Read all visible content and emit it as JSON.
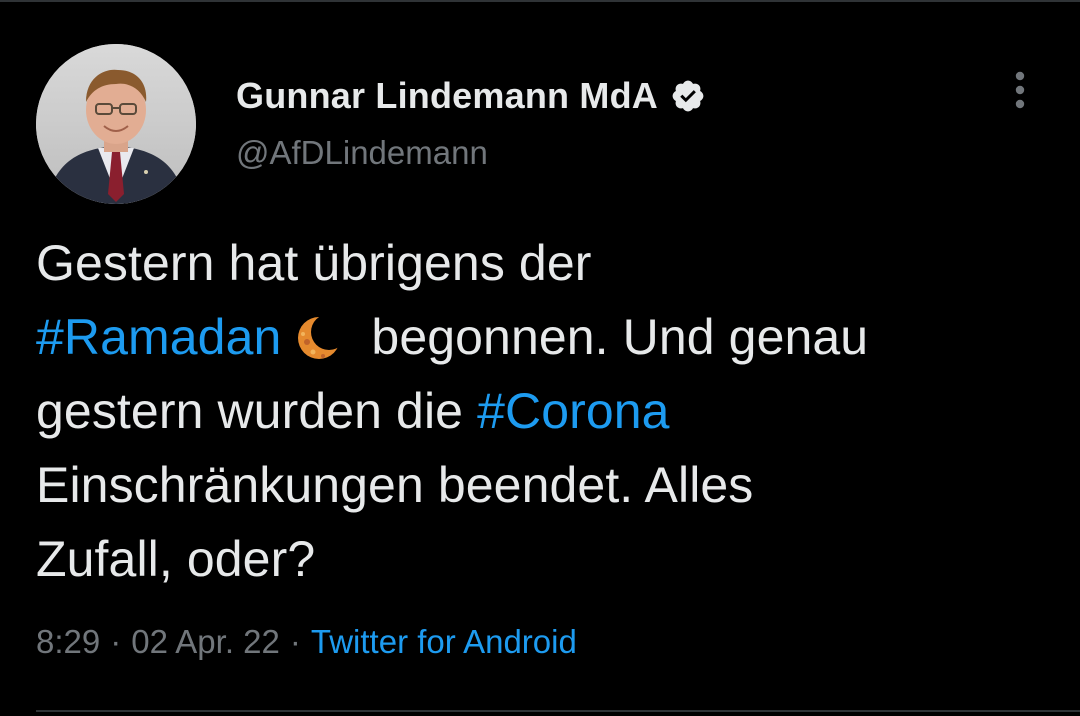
{
  "tweet": {
    "author": {
      "display_name": "Gunnar Lindemann MdA",
      "handle": "@AfDLindemann",
      "verified": true,
      "avatar_icon": "profile-photo-avatar"
    },
    "text_parts": {
      "line1": "Gestern hat übrigens der",
      "hashtag1": "#Ramadan",
      "emoji": "crescent-moon",
      "line2_rest": "begonnen. Und genau",
      "line3_start": "gestern wurden die",
      "hashtag2": "#Corona",
      "line4": "Einschränkungen beendet. Alles",
      "line5": "Zufall, oder?"
    },
    "meta": {
      "time": "8:29",
      "separator": "·",
      "date": "02 Apr. 22",
      "source": "Twitter for Android"
    },
    "more_icon": "more-vertical-icon"
  },
  "colors": {
    "background": "#000000",
    "text": "#e7e9ea",
    "secondary": "#71767b",
    "link": "#1d9bf0",
    "divider": "#2f3336"
  }
}
